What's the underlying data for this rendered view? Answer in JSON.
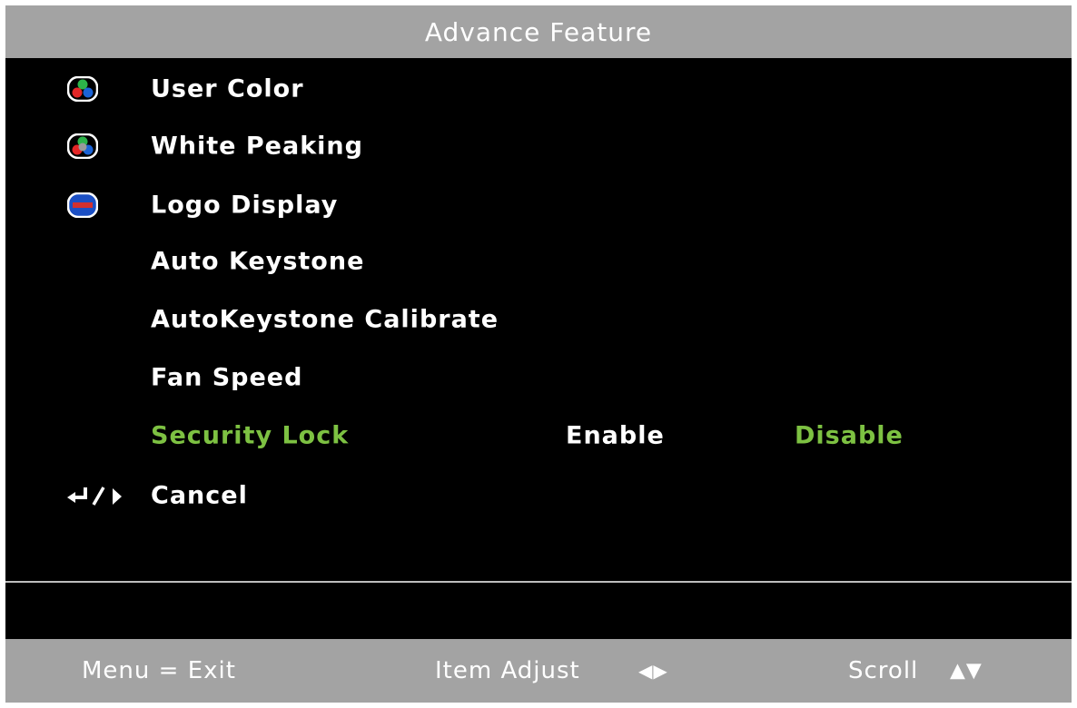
{
  "title": "Advance Feature",
  "menu": {
    "items": [
      {
        "label": "User Color",
        "icon": "rgb-color-icon"
      },
      {
        "label": "White Peaking",
        "icon": "rgb-white-icon"
      },
      {
        "label": "Logo Display",
        "icon": "logo-icon"
      },
      {
        "label": "Auto Keystone"
      },
      {
        "label": "AutoKeystone Calibrate"
      },
      {
        "label": "Fan Speed"
      },
      {
        "label": "Security Lock",
        "selected": true,
        "options": [
          "Enable",
          "Disable"
        ],
        "active_option": "Disable"
      },
      {
        "label": "Cancel",
        "icon": "enter-right-icon"
      }
    ]
  },
  "footer": {
    "exit": "Menu = Exit",
    "adjust": "Item Adjust",
    "adjust_glyph": "◀▶",
    "scroll": "Scroll",
    "scroll_glyph": "▲▼"
  },
  "colors": {
    "background": "#000000",
    "bar": "#a3a3a3",
    "highlight": "#7dc142",
    "text": "#ffffff"
  }
}
